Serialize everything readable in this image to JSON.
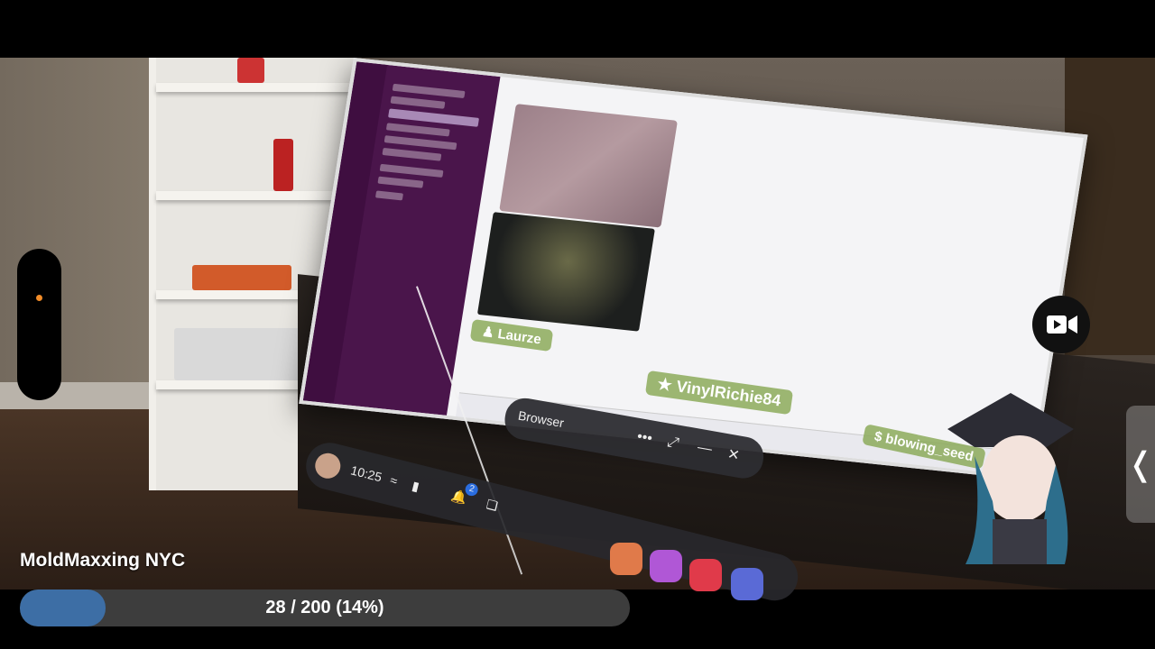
{
  "stream": {
    "title": "MoldMaxxing NYC"
  },
  "progress": {
    "text": "28 / 200 (14%)",
    "fraction": 0.14
  },
  "headset_bar": {
    "time": "10:25",
    "notification_count": "2"
  },
  "browser_window": {
    "title": "Browser",
    "more": "•••",
    "expand": "⤢",
    "minimize": "—",
    "close": "✕"
  },
  "chat_tags": [
    {
      "name": "Laurze",
      "icon": "person-icon"
    },
    {
      "name": "VinylRichie84",
      "icon": "star-icon"
    },
    {
      "name": "blowing_seed",
      "icon": "dollar-icon"
    }
  ],
  "side_handle": {
    "glyph": "❬"
  },
  "colors": {
    "progress_fill": "#3d6ea5",
    "progress_track": "#3d3d3d",
    "accent_dot": "#f28c28",
    "tag_bg": "#8caa5a"
  }
}
